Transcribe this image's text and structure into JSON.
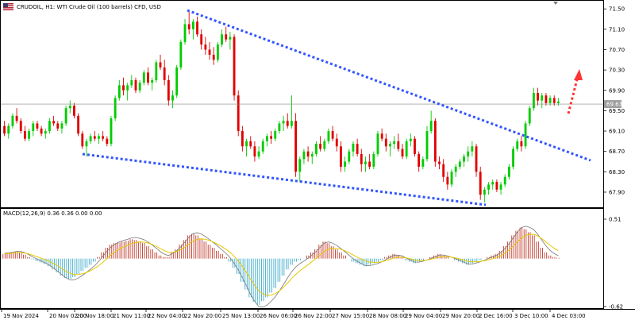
{
  "header": {
    "symbol_text": "CRUDOIL, H1:  WTI Crude Oil (100 barrels) CFD, USD"
  },
  "macd_header": {
    "text": "MACD(12,26,9) 0.36 0.36 0.00 0.00"
  },
  "colors": {
    "bull_candle": "#00cc00",
    "bear_candle": "#e00000",
    "trendline": "#3355ff",
    "arrow": "#ff3333",
    "macd_signal": "#e6c800",
    "macd_line": "#777777",
    "hist_pos": "#c0392b",
    "hist_neg": "#3aa9c9",
    "price_box": "#9e9e9e"
  },
  "chart_data": {
    "type": "candlestick",
    "price_axis_labels": [
      "71.50",
      "71.10",
      "70.70",
      "70.30",
      "69.90",
      "69.50",
      "69.10",
      "68.70",
      "68.30",
      "67.90"
    ],
    "current_price_label": "69.63",
    "macd_axis_labels": [
      "0.51",
      "-0.62"
    ],
    "x_axis_labels": [
      "19 Nov 2024",
      "20 Nov 02:00",
      "20 Nov 18:00",
      "21 Nov 11:00",
      "22 Nov 04:00",
      "22 Nov 20:00",
      "25 Nov 13:00",
      "26 Nov 06:00",
      "26 Nov 22:00",
      "27 Nov 15:00",
      "28 Nov 08:00",
      "29 Nov 04:00",
      "29 Nov 20:00",
      "2 Dec 16:00",
      "3 Dec 10:00",
      "4 Dec 03:00"
    ],
    "ylim": [
      67.65,
      71.55
    ],
    "macd_ylim": [
      -0.62,
      0.51
    ],
    "candles": [
      [
        69.2,
        69.3,
        69.0,
        69.05
      ],
      [
        69.05,
        69.25,
        68.95,
        69.2
      ],
      [
        69.2,
        69.45,
        69.15,
        69.4
      ],
      [
        69.4,
        69.55,
        69.25,
        69.3
      ],
      [
        69.3,
        69.35,
        69.05,
        69.1
      ],
      [
        69.1,
        69.2,
        68.9,
        68.95
      ],
      [
        68.95,
        69.15,
        68.9,
        69.1
      ],
      [
        69.1,
        69.3,
        69.0,
        69.25
      ],
      [
        69.25,
        69.3,
        69.1,
        69.15
      ],
      [
        69.15,
        69.2,
        69.0,
        69.05
      ],
      [
        69.05,
        69.15,
        68.95,
        69.1
      ],
      [
        69.1,
        69.35,
        69.05,
        69.3
      ],
      [
        69.3,
        69.4,
        69.2,
        69.25
      ],
      [
        69.25,
        69.3,
        69.1,
        69.15
      ],
      [
        69.15,
        69.3,
        69.05,
        69.25
      ],
      [
        69.25,
        69.6,
        69.2,
        69.55
      ],
      [
        69.55,
        69.7,
        69.45,
        69.6
      ],
      [
        69.6,
        69.65,
        69.35,
        69.4
      ],
      [
        69.4,
        69.45,
        69.0,
        69.05
      ],
      [
        69.05,
        69.1,
        68.75,
        68.8
      ],
      [
        68.8,
        68.95,
        68.6,
        68.9
      ],
      [
        68.9,
        69.05,
        68.85,
        69.0
      ],
      [
        69.0,
        69.1,
        68.9,
        68.95
      ],
      [
        68.95,
        69.05,
        68.85,
        69.0
      ],
      [
        69.0,
        69.1,
        68.9,
        68.95
      ],
      [
        68.95,
        69.0,
        68.8,
        68.85
      ],
      [
        68.85,
        69.4,
        68.8,
        69.35
      ],
      [
        69.35,
        69.8,
        69.3,
        69.75
      ],
      [
        69.75,
        70.1,
        69.7,
        70.0
      ],
      [
        70.0,
        70.15,
        69.8,
        69.9
      ],
      [
        69.9,
        70.05,
        69.7,
        70.0
      ],
      [
        70.0,
        70.2,
        69.95,
        70.1
      ],
      [
        70.1,
        70.15,
        69.85,
        69.9
      ],
      [
        69.9,
        70.1,
        69.85,
        70.05
      ],
      [
        70.05,
        70.3,
        70.0,
        70.25
      ],
      [
        70.25,
        70.35,
        70.0,
        70.05
      ],
      [
        70.05,
        70.15,
        69.9,
        70.1
      ],
      [
        70.1,
        70.5,
        70.05,
        70.45
      ],
      [
        70.45,
        70.6,
        70.3,
        70.35
      ],
      [
        70.35,
        70.5,
        70.0,
        70.1
      ],
      [
        70.1,
        70.2,
        69.6,
        69.7
      ],
      [
        69.7,
        69.9,
        69.55,
        69.8
      ],
      [
        69.8,
        70.4,
        69.75,
        70.35
      ],
      [
        70.35,
        70.9,
        70.3,
        70.85
      ],
      [
        70.85,
        71.3,
        70.8,
        71.2
      ],
      [
        71.2,
        71.45,
        71.0,
        71.1
      ],
      [
        71.1,
        71.3,
        70.9,
        71.25
      ],
      [
        71.25,
        71.35,
        70.95,
        71.0
      ],
      [
        71.0,
        71.1,
        70.7,
        70.8
      ],
      [
        70.8,
        70.95,
        70.6,
        70.7
      ],
      [
        70.7,
        70.85,
        70.5,
        70.6
      ],
      [
        70.6,
        70.75,
        70.4,
        70.5
      ],
      [
        70.5,
        70.85,
        70.45,
        70.8
      ],
      [
        70.8,
        71.1,
        70.75,
        71.0
      ],
      [
        71.0,
        71.15,
        70.85,
        70.9
      ],
      [
        70.9,
        71.05,
        70.7,
        70.95
      ],
      [
        70.95,
        71.0,
        69.7,
        69.8
      ],
      [
        69.8,
        69.9,
        69.0,
        69.1
      ],
      [
        69.1,
        69.2,
        68.7,
        68.8
      ],
      [
        68.8,
        68.95,
        68.6,
        68.9
      ],
      [
        68.9,
        69.0,
        68.75,
        68.8
      ],
      [
        68.8,
        68.9,
        68.5,
        68.6
      ],
      [
        68.6,
        68.8,
        68.55,
        68.7
      ],
      [
        68.7,
        68.95,
        68.65,
        68.9
      ],
      [
        68.9,
        69.05,
        68.8,
        69.0
      ],
      [
        69.0,
        69.1,
        68.85,
        68.95
      ],
      [
        68.95,
        69.15,
        68.9,
        69.1
      ],
      [
        69.1,
        69.3,
        69.05,
        69.25
      ],
      [
        69.25,
        69.4,
        69.1,
        69.3
      ],
      [
        69.3,
        69.45,
        69.15,
        69.2
      ],
      [
        69.2,
        69.8,
        69.15,
        69.3
      ],
      [
        69.3,
        69.45,
        68.2,
        68.3
      ],
      [
        68.3,
        68.6,
        68.1,
        68.55
      ],
      [
        68.55,
        68.75,
        68.45,
        68.7
      ],
      [
        68.7,
        68.8,
        68.5,
        68.6
      ],
      [
        68.6,
        68.7,
        68.45,
        68.65
      ],
      [
        68.65,
        68.9,
        68.6,
        68.85
      ],
      [
        68.85,
        69.0,
        68.7,
        68.75
      ],
      [
        68.75,
        68.95,
        68.7,
        68.9
      ],
      [
        68.9,
        69.15,
        68.85,
        69.1
      ],
      [
        69.1,
        69.2,
        68.9,
        68.95
      ],
      [
        68.95,
        69.05,
        68.7,
        68.8
      ],
      [
        68.8,
        68.9,
        68.3,
        68.4
      ],
      [
        68.4,
        68.6,
        68.3,
        68.5
      ],
      [
        68.5,
        68.75,
        68.45,
        68.7
      ],
      [
        68.7,
        68.9,
        68.6,
        68.85
      ],
      [
        68.85,
        68.95,
        68.6,
        68.65
      ],
      [
        68.65,
        68.75,
        68.3,
        68.45
      ],
      [
        68.45,
        68.6,
        68.3,
        68.5
      ],
      [
        68.5,
        68.65,
        68.35,
        68.4
      ],
      [
        68.4,
        68.7,
        68.35,
        68.65
      ],
      [
        68.65,
        69.1,
        68.6,
        69.05
      ],
      [
        69.05,
        69.15,
        68.9,
        68.95
      ],
      [
        68.95,
        69.05,
        68.7,
        68.8
      ],
      [
        68.8,
        68.9,
        68.6,
        68.85
      ],
      [
        68.85,
        69.0,
        68.75,
        68.9
      ],
      [
        68.9,
        69.05,
        68.7,
        68.75
      ],
      [
        68.75,
        68.85,
        68.55,
        68.6
      ],
      [
        68.6,
        68.95,
        68.55,
        68.9
      ],
      [
        68.9,
        69.05,
        68.8,
        68.95
      ],
      [
        68.95,
        69.0,
        68.6,
        68.65
      ],
      [
        68.65,
        68.7,
        68.3,
        68.4
      ],
      [
        68.4,
        68.6,
        68.35,
        68.55
      ],
      [
        68.55,
        69.2,
        68.5,
        69.1
      ],
      [
        69.1,
        69.5,
        69.05,
        69.3
      ],
      [
        69.3,
        69.35,
        68.4,
        68.5
      ],
      [
        68.5,
        68.6,
        68.35,
        68.45
      ],
      [
        68.45,
        68.55,
        68.1,
        68.2
      ],
      [
        68.2,
        68.3,
        67.95,
        68.05
      ],
      [
        68.05,
        68.35,
        68.0,
        68.3
      ],
      [
        68.3,
        68.45,
        68.2,
        68.4
      ],
      [
        68.4,
        68.55,
        68.35,
        68.5
      ],
      [
        68.5,
        68.65,
        68.4,
        68.6
      ],
      [
        68.6,
        68.8,
        68.5,
        68.7
      ],
      [
        68.7,
        68.9,
        68.6,
        68.8
      ],
      [
        68.8,
        68.85,
        68.2,
        68.3
      ],
      [
        68.3,
        68.4,
        67.75,
        67.85
      ],
      [
        67.85,
        68.0,
        67.7,
        67.95
      ],
      [
        67.95,
        68.1,
        67.85,
        68.05
      ],
      [
        68.05,
        68.15,
        67.95,
        68.1
      ],
      [
        68.1,
        68.15,
        67.9,
        67.95
      ],
      [
        67.95,
        68.1,
        67.85,
        68.05
      ],
      [
        68.05,
        68.25,
        68.0,
        68.2
      ],
      [
        68.2,
        68.45,
        68.15,
        68.4
      ],
      [
        68.4,
        68.8,
        68.35,
        68.75
      ],
      [
        68.75,
        68.95,
        68.7,
        68.9
      ],
      [
        68.9,
        69.0,
        68.7,
        68.8
      ],
      [
        68.8,
        69.3,
        68.75,
        69.25
      ],
      [
        69.25,
        69.6,
        69.2,
        69.55
      ],
      [
        69.55,
        69.95,
        69.5,
        69.85
      ],
      [
        69.85,
        69.95,
        69.6,
        69.7
      ],
      [
        69.7,
        69.85,
        69.55,
        69.8
      ],
      [
        69.8,
        69.85,
        69.6,
        69.65
      ],
      [
        69.65,
        69.8,
        69.6,
        69.75
      ],
      [
        69.75,
        69.8,
        69.6,
        69.65
      ],
      [
        69.65,
        69.75,
        69.6,
        69.68
      ]
    ],
    "macd_hist": [
      0.06,
      0.07,
      0.08,
      0.09,
      0.08,
      0.05,
      0.02,
      -0.01,
      -0.03,
      -0.05,
      -0.07,
      -0.1,
      -0.14,
      -0.18,
      -0.22,
      -0.25,
      -0.26,
      -0.24,
      -0.2,
      -0.16,
      -0.12,
      -0.08,
      -0.04,
      0.02,
      0.08,
      0.14,
      0.18,
      0.2,
      0.21,
      0.22,
      0.23,
      0.25,
      0.24,
      0.22,
      0.2,
      0.16,
      0.12,
      0.08,
      0.04,
      0.02,
      0.02,
      0.08,
      0.12,
      0.18,
      0.24,
      0.3,
      0.32,
      0.3,
      0.26,
      0.22,
      0.18,
      0.14,
      0.1,
      0.06,
      0.02,
      -0.04,
      -0.12,
      -0.2,
      -0.3,
      -0.4,
      -0.5,
      -0.56,
      -0.6,
      -0.55,
      -0.5,
      -0.44,
      -0.38,
      -0.3,
      -0.22,
      -0.14,
      -0.08,
      -0.04,
      -0.02,
      0.0,
      0.04,
      0.08,
      0.12,
      0.18,
      0.22,
      0.2,
      0.16,
      0.12,
      0.08,
      0.04,
      0.0,
      -0.04,
      -0.06,
      -0.08,
      -0.1,
      -0.08,
      -0.06,
      -0.04,
      -0.02,
      0.02,
      0.04,
      0.06,
      0.04,
      0.02,
      -0.02,
      -0.04,
      -0.06,
      -0.04,
      -0.02,
      0.0,
      0.02,
      0.04,
      0.06,
      0.04,
      0.02,
      0.0,
      -0.02,
      -0.04,
      -0.06,
      -0.08,
      -0.06,
      -0.04,
      -0.02,
      0.0,
      0.02,
      0.04,
      0.06,
      0.1,
      0.16,
      0.22,
      0.3,
      0.36,
      0.4,
      0.38,
      0.34,
      0.3,
      0.22,
      0.14,
      0.08,
      0.04,
      0.02,
      0.01
    ]
  }
}
